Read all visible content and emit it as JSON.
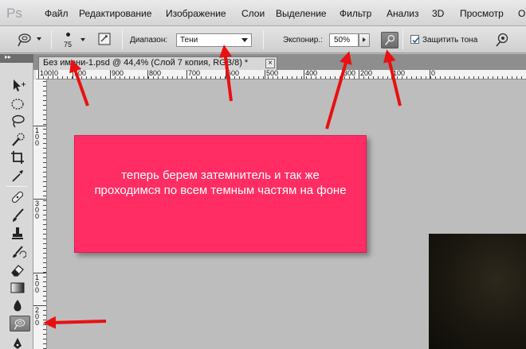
{
  "app": {
    "logo": "Ps"
  },
  "menu": [
    "Файл",
    "Редактирование",
    "Изображение",
    "Слои",
    "Выделение",
    "Фильтр",
    "Анализ",
    "3D",
    "Просмотр",
    "Окно"
  ],
  "options": {
    "brush_size": "75",
    "range_label": "Диапазон:",
    "range_value": "Тени",
    "exposure_label": "Экспонир.:",
    "exposure_value": "50%",
    "protect_tones_label": "Защитить тона",
    "protect_tones_checked": true
  },
  "toolbox": {
    "collapse_glyph": "▸▸",
    "active_tool": "dodge-burn-tool"
  },
  "document": {
    "tab_title": "Без имени-1.psd @ 44,4% (Слой 7 копия, RGB/8) *",
    "close_glyph": "×"
  },
  "ruler": {
    "top_labels": [
      "100",
      "0",
      "100",
      "900",
      "800",
      "700",
      "600",
      "500",
      "400",
      "300",
      "200",
      "100",
      "0"
    ],
    "left_labels": [
      "1\n0\n0",
      "3\n0\n0",
      "1\n0\n0",
      "2\n0\n0"
    ]
  },
  "annotation": {
    "text": "теперь берем затемнитель и так же проходимся по всем темным частям на фоне",
    "color": "#ff2d63",
    "arrow_color": "#e81010"
  }
}
